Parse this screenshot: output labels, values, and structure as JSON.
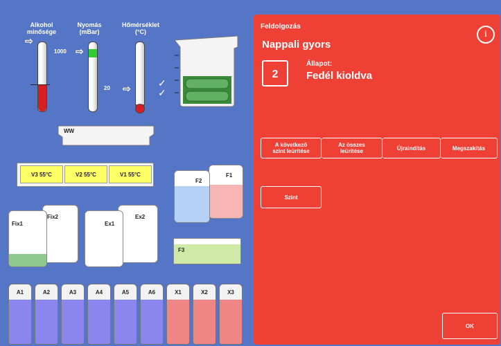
{
  "gauges": {
    "alcohol_label": "Alkohol\nminősége",
    "pressure_label": "Nyomás\n(mBar)",
    "temperature_label": "Hőmérséklet\n(°C)",
    "pressure_value": "1000",
    "temperature_value": "20"
  },
  "waste": {
    "label": "WW"
  },
  "wax": [
    {
      "label": "V3  55°C"
    },
    {
      "label": "V2  55°C"
    },
    {
      "label": "V1  55°C"
    }
  ],
  "containers": {
    "fix1": "Fix1",
    "fix2": "Fix2",
    "ex1": "Ex1",
    "ex2": "Ex2",
    "f1": "F1",
    "f2": "F2",
    "f3": "F3"
  },
  "reagents": [
    "A1",
    "A2",
    "A3",
    "A4",
    "A5",
    "A6",
    "X1",
    "X2",
    "X3"
  ],
  "panel": {
    "section_title": "Feldolgozás",
    "protocol_name": "Nappali gyors",
    "step_number": "2",
    "status_label": "Állapot:",
    "status_value": "Fedél kioldva",
    "info_icon": "i",
    "buttons": {
      "drain_next": "A következő\nszint leürítése",
      "drain_all": "Az összes\nleürítése",
      "restart": "Újraindítás",
      "abort": "Megszakítás",
      "level": "Szint",
      "ok": "OK"
    }
  },
  "colors": {
    "panel": "#ee4035",
    "background": "#5575c6",
    "wax": "#ffff66"
  }
}
